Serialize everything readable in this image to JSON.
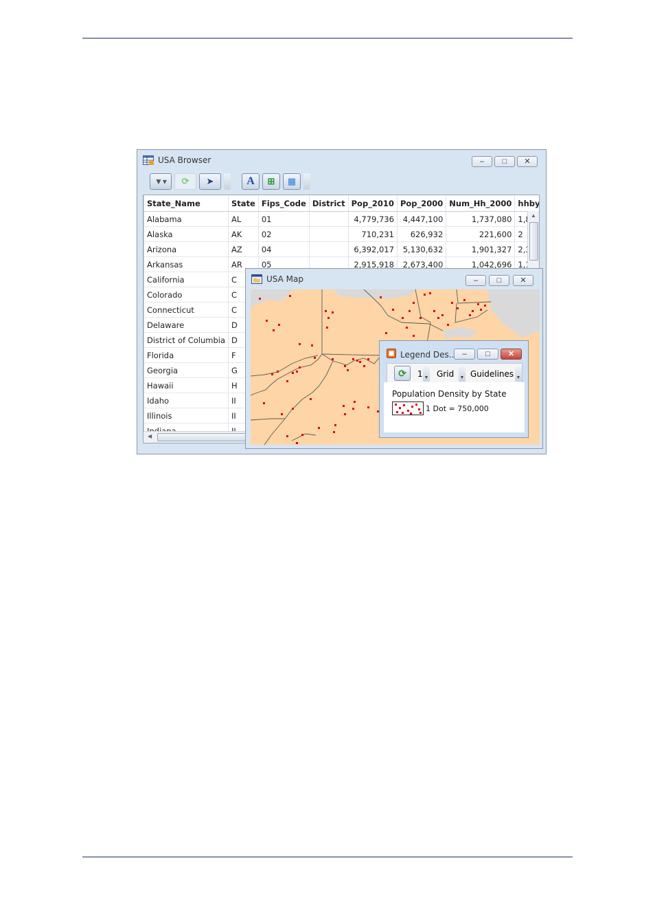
{
  "browser": {
    "title": "USA Browser",
    "columns": [
      "State_Name",
      "State",
      "Fips_Code",
      "District",
      "Pop_2010",
      "Pop_2000",
      "Num_Hh_2000",
      "hhby"
    ],
    "rows": [
      [
        "Alabama",
        "AL",
        "01",
        "",
        "4,779,736",
        "4,447,100",
        "1,737,080",
        "1,8"
      ],
      [
        "Alaska",
        "AK",
        "02",
        "",
        "710,231",
        "626,932",
        "221,600",
        "2"
      ],
      [
        "Arizona",
        "AZ",
        "04",
        "",
        "6,392,017",
        "5,130,632",
        "1,901,327",
        "2,3"
      ],
      [
        "Arkansas",
        "AR",
        "05",
        "",
        "2,915,918",
        "2,673,400",
        "1,042,696",
        "1,1"
      ],
      [
        "California",
        "C",
        "",
        "",
        "",
        "",
        "",
        ""
      ],
      [
        "Colorado",
        "C",
        "",
        "",
        "",
        "",
        "",
        ""
      ],
      [
        "Connecticut",
        "C",
        "",
        "",
        "",
        "",
        "",
        ""
      ],
      [
        "Delaware",
        "D",
        "",
        "",
        "",
        "",
        "",
        ""
      ],
      [
        "District of Columbia",
        "D",
        "",
        "",
        "",
        "",
        "",
        ""
      ],
      [
        "Florida",
        "F",
        "",
        "",
        "",
        "",
        "",
        ""
      ],
      [
        "Georgia",
        "G",
        "",
        "",
        "",
        "",
        "",
        ""
      ],
      [
        "Hawaii",
        "H",
        "",
        "",
        "",
        "",
        "",
        ""
      ],
      [
        "Idaho",
        "II",
        "",
        "",
        "",
        "",
        "",
        ""
      ],
      [
        "Illinois",
        "II",
        "",
        "",
        "",
        "",
        "",
        ""
      ],
      [
        "Indiana",
        "II",
        "",
        "",
        "",
        "",
        "",
        ""
      ]
    ]
  },
  "map": {
    "title": "USA Map",
    "land_color": "#fdd5a6",
    "water_color": "#d9d9d9",
    "dot_color": "#e0000b"
  },
  "legend": {
    "title": "Legend Des...",
    "field_value": "1",
    "grid_label": "Grid",
    "guidelines_label": "Guidelines",
    "heading": "Population Density by State",
    "item_label": "1 Dot = 750,000"
  },
  "icons": {
    "browser_title": "table-icon",
    "map_title": "map-icon",
    "legend_title": "legend-icon",
    "tool_1": "filter-icon",
    "tool_2": "refresh-icon",
    "tool_3": "pointer-icon",
    "tool_4": "font-icon",
    "tool_5": "add-column-icon",
    "tool_6": "columns-icon"
  }
}
